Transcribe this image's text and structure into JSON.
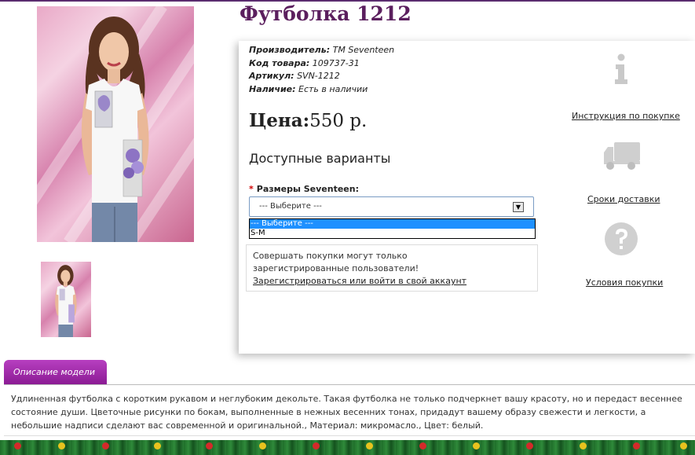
{
  "product": {
    "title": "Футболка 1212",
    "info": [
      {
        "label": "Производитель:",
        "value": "TM Seventeen"
      },
      {
        "label": "Код товара:",
        "value": "109737-31"
      },
      {
        "label": "Артикул:",
        "value": "SVN-1212"
      },
      {
        "label": "Наличие:",
        "value": "Есть в наличии"
      }
    ],
    "price_label": "Цена:",
    "price_value": "550 р.",
    "variants_heading": "Доступные варианты"
  },
  "options": {
    "size_label": "Размеры Seventeen:",
    "required_mark": "*",
    "selected": "--- Выберите ---",
    "list": [
      "--- Выберите ---",
      "S-M"
    ]
  },
  "notice": {
    "text": "Совершать покупки могут только зарегистрированные пользователи!",
    "link": "Зарегистрироваться или войти в свой аккаунт"
  },
  "sidebar": {
    "items": [
      {
        "icon": "info-icon",
        "label": "Инструкция по покупке"
      },
      {
        "icon": "truck-icon",
        "label": "Сроки доставки"
      },
      {
        "icon": "question-icon",
        "label": "Условия покупки"
      }
    ]
  },
  "description": {
    "tab_label": "Описание модели",
    "text": "Удлиненная футболка с коротким рукавом и неглубоким декольте. Такая футболка не только подчеркнет вашу красоту, но и передаст весеннее состояние души. Цветочные рисунки по бокам, выполненные в нежных весенних тонах, придадут вашему образу свежести и легкости, а небольшие надписи сделают вас современной и оригинальной., Материал: микромасло., Цвет: белый."
  },
  "colors": {
    "title": "#5b1f5e",
    "tab": "#9b2aa5",
    "dropdown_highlight": "#1e90ff",
    "garland": "#1f6e2a"
  }
}
